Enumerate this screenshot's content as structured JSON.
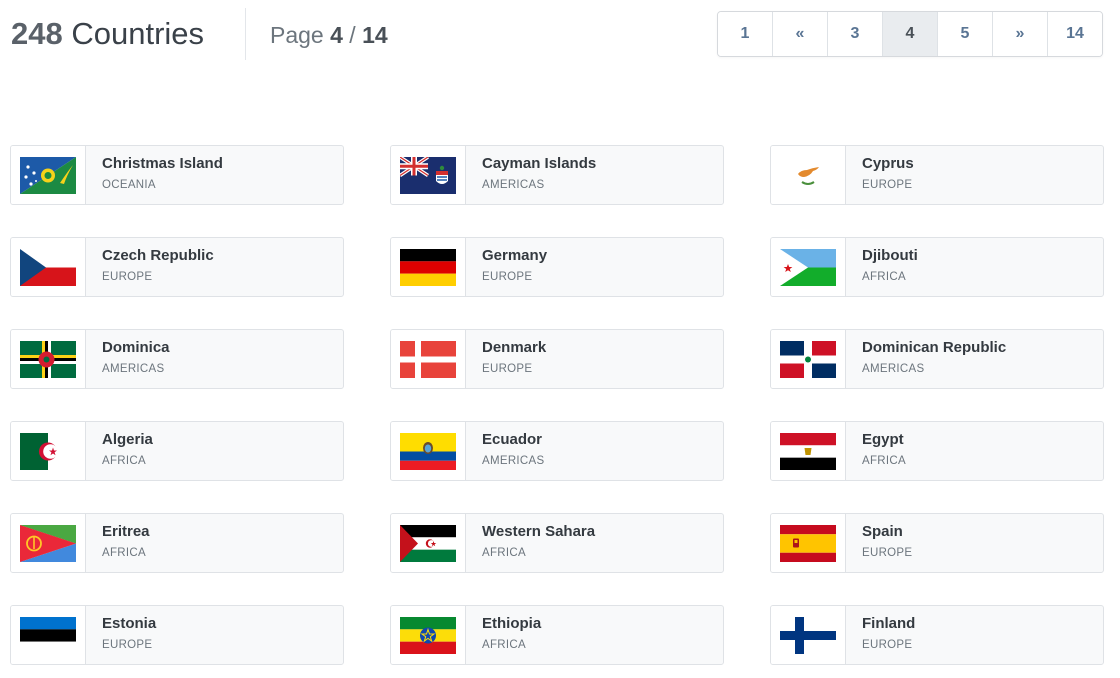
{
  "header": {
    "count": "248",
    "count_label": " Countries",
    "page_prefix": "Page ",
    "page_current": "4",
    "page_sep": " / ",
    "page_total": "14"
  },
  "pagination": [
    "1",
    "«",
    "3",
    "4",
    "5",
    "»",
    "14"
  ],
  "countries": [
    {
      "name": "Christmas Island",
      "region": "OCEANIA",
      "flag": "christmas-island-flag-icon"
    },
    {
      "name": "Cayman Islands",
      "region": "AMERICAS",
      "flag": "cayman-islands-flag-icon"
    },
    {
      "name": "Cyprus",
      "region": "EUROPE",
      "flag": "cyprus-flag-icon"
    },
    {
      "name": "Czech Republic",
      "region": "EUROPE",
      "flag": "czech-republic-flag-icon"
    },
    {
      "name": "Germany",
      "region": "EUROPE",
      "flag": "germany-flag-icon"
    },
    {
      "name": "Djibouti",
      "region": "AFRICA",
      "flag": "djibouti-flag-icon"
    },
    {
      "name": "Dominica",
      "region": "AMERICAS",
      "flag": "dominica-flag-icon"
    },
    {
      "name": "Denmark",
      "region": "EUROPE",
      "flag": "denmark-flag-icon"
    },
    {
      "name": "Dominican Republic",
      "region": "AMERICAS",
      "flag": "dominican-republic-flag-icon"
    },
    {
      "name": "Algeria",
      "region": "AFRICA",
      "flag": "algeria-flag-icon"
    },
    {
      "name": "Ecuador",
      "region": "AMERICAS",
      "flag": "ecuador-flag-icon"
    },
    {
      "name": "Egypt",
      "region": "AFRICA",
      "flag": "egypt-flag-icon"
    },
    {
      "name": "Eritrea",
      "region": "AFRICA",
      "flag": "eritrea-flag-icon"
    },
    {
      "name": "Western Sahara",
      "region": "AFRICA",
      "flag": "western-sahara-flag-icon"
    },
    {
      "name": "Spain",
      "region": "EUROPE",
      "flag": "spain-flag-icon"
    },
    {
      "name": "Estonia",
      "region": "EUROPE",
      "flag": "estonia-flag-icon"
    },
    {
      "name": "Ethiopia",
      "region": "AFRICA",
      "flag": "ethiopia-flag-icon"
    },
    {
      "name": "Finland",
      "region": "EUROPE",
      "flag": "finland-flag-icon"
    }
  ]
}
